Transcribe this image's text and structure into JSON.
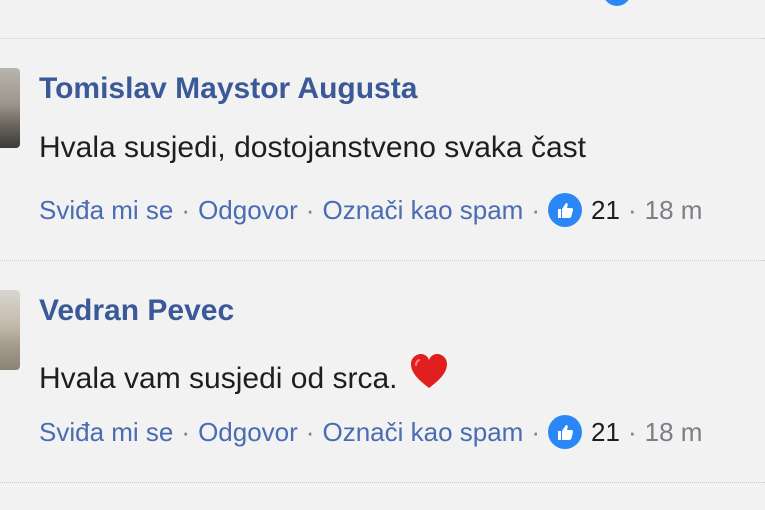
{
  "comments": [
    {
      "author": "Tomislav Maystor Augusta",
      "text": "Hvala susjedi, dostojanstveno svaka čast",
      "like_label": "Sviđa mi se",
      "reply_label": "Odgovor",
      "spam_label": "Označi kao spam",
      "likes": "21",
      "time": "18 m"
    },
    {
      "author": "Vedran Pevec",
      "text": "Hvala vam susjedi od srca.",
      "like_label": "Sviđa mi se",
      "reply_label": "Odgovor",
      "spam_label": "Označi kao spam",
      "likes": "21",
      "time": "18 m"
    }
  ],
  "separator": "·",
  "icons": {
    "like": "thumbs-up-icon",
    "heart": "red-heart-emoji"
  },
  "colors": {
    "link": "#4a6cb2",
    "name": "#3b5998",
    "like_badge": "#2b87f6",
    "heart": "#e0201f"
  }
}
